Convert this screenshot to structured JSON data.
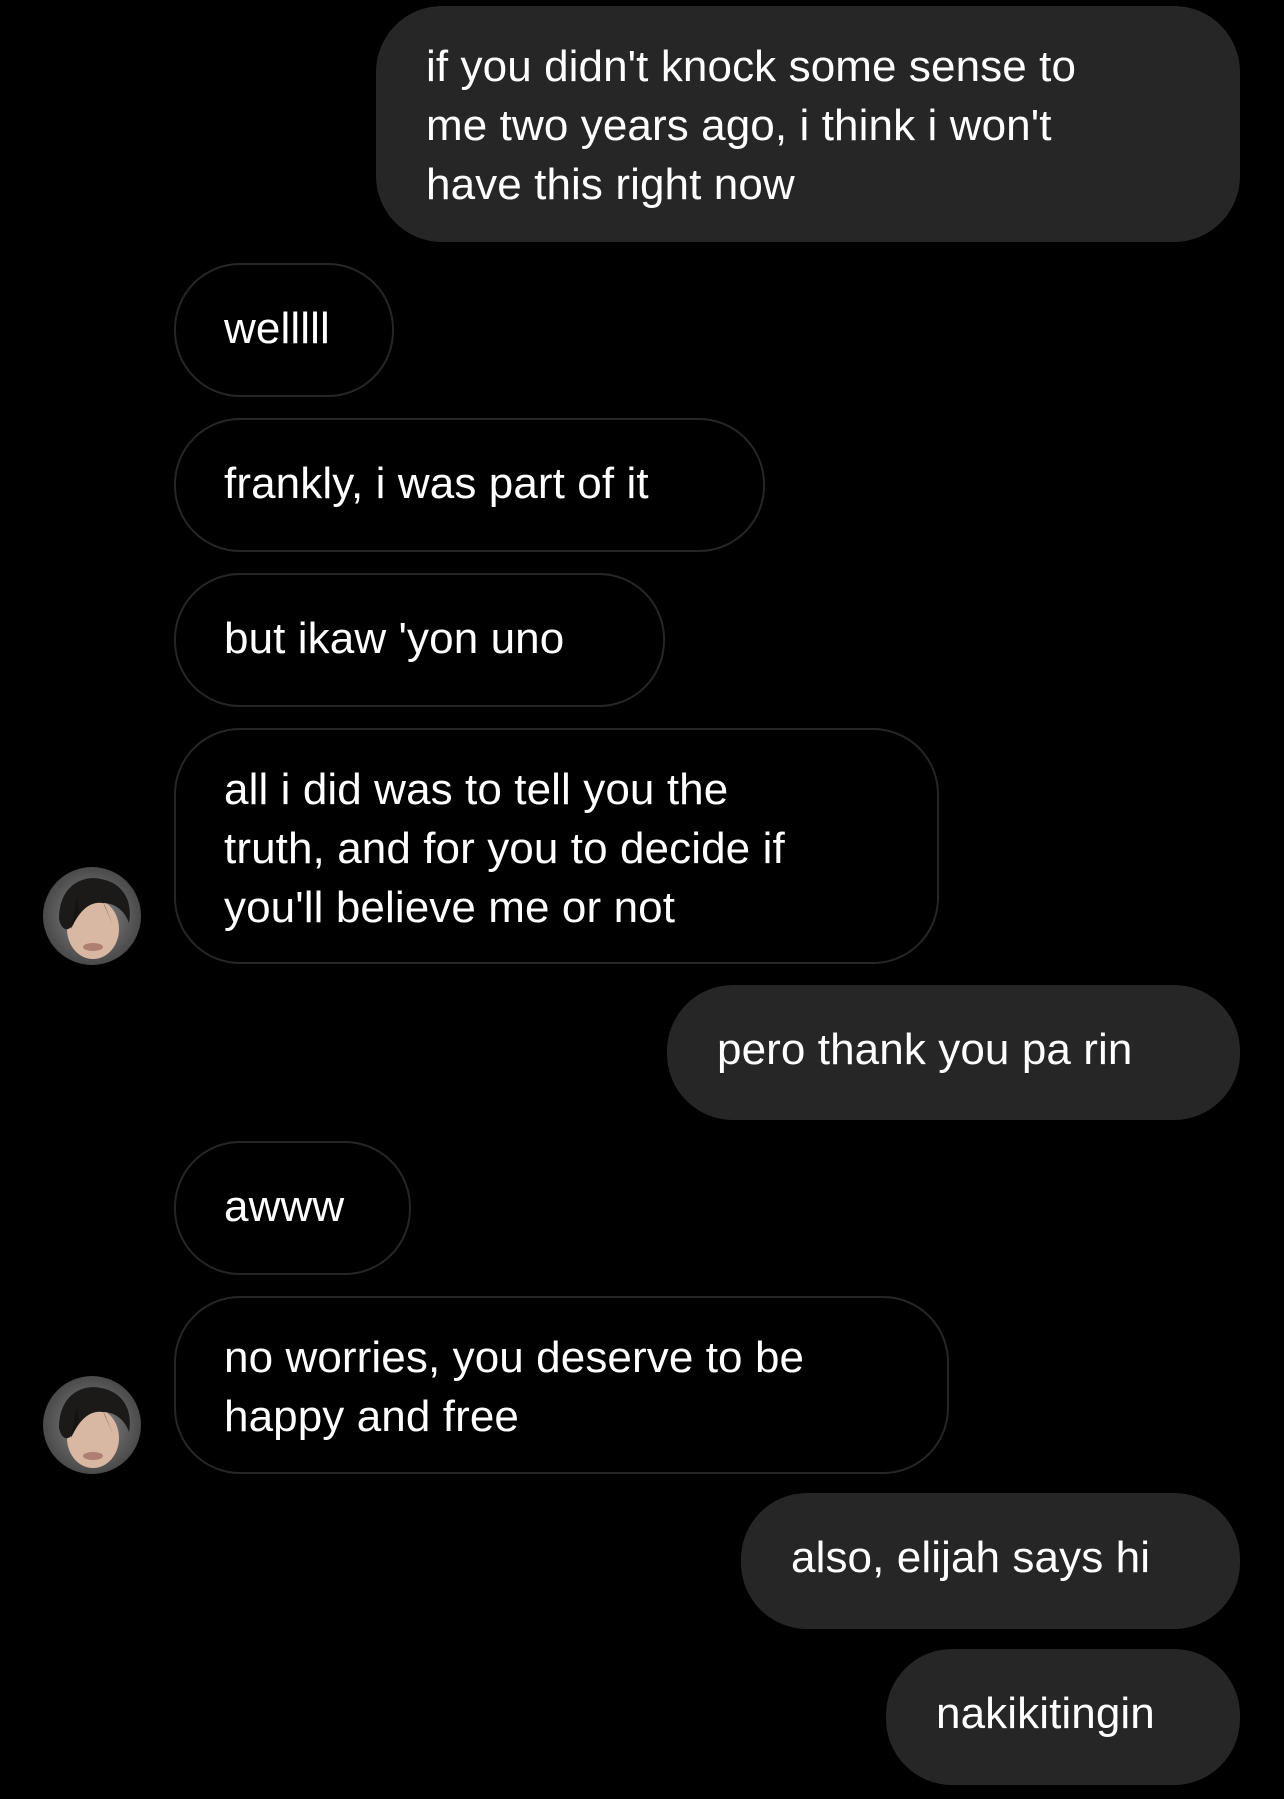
{
  "conversation": {
    "messages": [
      {
        "sender": "me",
        "text": "if you didn't knock some sense to\nme two years ago, i think i won't\nhave this right now"
      },
      {
        "sender": "them",
        "text": "welllll"
      },
      {
        "sender": "them",
        "text": "frankly, i was part of it"
      },
      {
        "sender": "them",
        "text": "but ikaw 'yon uno"
      },
      {
        "sender": "them",
        "text": "all i did was to tell you the\ntruth, and for you to decide if\nyou'll believe me or not"
      },
      {
        "sender": "me",
        "text": "pero thank you pa rin"
      },
      {
        "sender": "them",
        "text": "awww"
      },
      {
        "sender": "them",
        "text": "no worries, you deserve to be\nhappy and free"
      },
      {
        "sender": "me",
        "text": "also, elijah says hi"
      },
      {
        "sender": "me",
        "text": "nakikitingin"
      }
    ]
  },
  "colors": {
    "background": "#000000",
    "sent_bubble": "#262626",
    "received_border": "#262626",
    "text": "#ffffff"
  },
  "icons": {
    "avatar": "contact-profile-photo"
  }
}
